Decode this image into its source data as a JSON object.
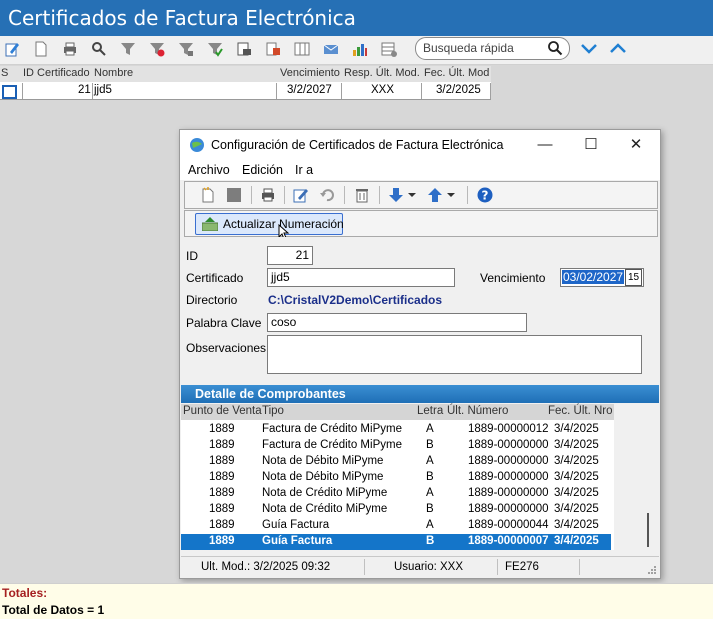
{
  "app": {
    "title": "Certificados de Factura Electrónica"
  },
  "search": {
    "placeholder": "Busqueda rápida"
  },
  "colors": {
    "title_bar": "#2670b5",
    "selected_row": "#1475c9",
    "detail_header": "#1f6fb6",
    "totals_label": "#a52020"
  },
  "toolbar_icons": [
    "edit-icon",
    "new-document-icon",
    "print-icon",
    "search-icon",
    "filter-icon",
    "filter-remove-icon",
    "filter-add-icon",
    "filter-apply-icon",
    "print-preview-icon",
    "export-icon",
    "columns-icon",
    "email-icon",
    "chart-icon",
    "grid-settings-icon"
  ],
  "main_grid": {
    "columns": [
      "S",
      "ID Certificado",
      "Nombre",
      "Vencimiento",
      "Resp. Últ. Mod.",
      "Fec. Últ. Mod"
    ],
    "rows": [
      {
        "id": "21",
        "nombre": "jjd5",
        "vencimiento": "3/2/2027",
        "resp": "XXX",
        "fecha": "3/2/2025"
      }
    ]
  },
  "dialog": {
    "title": "Configuración de Certificados de Factura Electrónica",
    "menu": [
      "Archivo",
      "Edición",
      "Ir a"
    ],
    "update_button": "Actualizar Numeración",
    "form": {
      "id_label": "ID",
      "id_value": "21",
      "certificado_label": "Certificado",
      "certificado_value": "jjd5",
      "vencimiento_label": "Vencimiento",
      "vencimiento_value": "03/02/2027",
      "vencimiento_calendar": "15",
      "directorio_label": "Directorio",
      "directorio_value": "C:\\CristalV2Demo\\Certificados",
      "clave_label": "Palabra Clave",
      "clave_value": "coso",
      "observaciones_label": "Observaciones",
      "observaciones_value": ""
    },
    "detail": {
      "header": "Detalle de Comprobantes",
      "columns": [
        "Punto de Venta",
        "Tipo",
        "Letra",
        "Últ. Número",
        "Fec. Últ. Nro"
      ],
      "rows": [
        {
          "pv": "1889",
          "tipo": "Factura de Crédito MiPyme",
          "letra": "A",
          "num": "1889-00000012",
          "fecha": "3/4/2025"
        },
        {
          "pv": "1889",
          "tipo": "Factura de Crédito MiPyme",
          "letra": "B",
          "num": "1889-00000000",
          "fecha": "3/4/2025"
        },
        {
          "pv": "1889",
          "tipo": "Nota de Débito MiPyme",
          "letra": "A",
          "num": "1889-00000000",
          "fecha": "3/4/2025"
        },
        {
          "pv": "1889",
          "tipo": "Nota de Débito MiPyme",
          "letra": "B",
          "num": "1889-00000000",
          "fecha": "3/4/2025"
        },
        {
          "pv": "1889",
          "tipo": "Nota de Crédito MiPyme",
          "letra": "A",
          "num": "1889-00000000",
          "fecha": "3/4/2025"
        },
        {
          "pv": "1889",
          "tipo": "Nota de Crédito MiPyme",
          "letra": "B",
          "num": "1889-00000000",
          "fecha": "3/4/2025"
        },
        {
          "pv": "1889",
          "tipo": "Guía Factura",
          "letra": "A",
          "num": "1889-00000044",
          "fecha": "3/4/2025"
        },
        {
          "pv": "1889",
          "tipo": "Guía Factura",
          "letra": "B",
          "num": "1889-00000007",
          "fecha": "3/4/2025"
        }
      ]
    },
    "status": {
      "ult_mod": "Ult. Mod.: 3/2/2025 09:32",
      "usuario": "Usuario: XXX",
      "code": "FE276"
    }
  },
  "totals": {
    "label": "Totales:",
    "total_datos": "Total de Datos = 1"
  }
}
